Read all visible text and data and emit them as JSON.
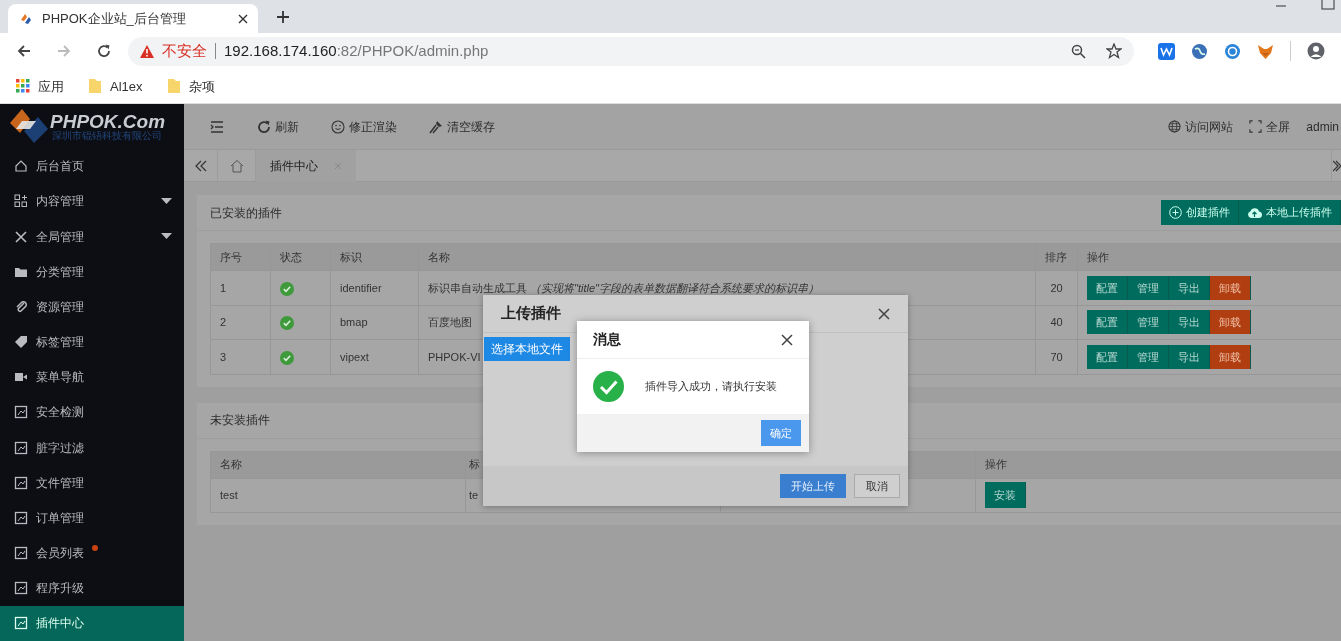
{
  "browser": {
    "tab_title": "PHPOK企业站_后台管理",
    "security_label": "不安全",
    "url_host": "192.168.174.160",
    "url_path": ":82/PHPOK/admin.php",
    "bookmarks": [
      {
        "kind": "apps",
        "label": "应用"
      },
      {
        "kind": "folder",
        "label": "Al1ex"
      },
      {
        "kind": "folder",
        "label": "杂项"
      }
    ]
  },
  "logo": {
    "brand": "PHPOK.Com",
    "company": "深圳市锟铻科技有限公司"
  },
  "toolbar": [
    {
      "kind": "menu"
    },
    {
      "kind": "refresh",
      "label": "刷新"
    },
    {
      "kind": "smile",
      "label": "修正渲染"
    },
    {
      "kind": "broom",
      "label": "清空缓存"
    }
  ],
  "header_right": [
    {
      "kind": "globe",
      "label": "访问网站"
    },
    {
      "kind": "fullscreen",
      "label": "全屏"
    },
    {
      "kind": "user",
      "label": "admin"
    }
  ],
  "page_tabs": [
    {
      "label": "插件中心",
      "selected": true
    }
  ],
  "sidebar": [
    {
      "kind": "home",
      "label": "后台首页",
      "expandable": false,
      "badge_dot": false,
      "selected": false
    },
    {
      "kind": "grid",
      "label": "内容管理",
      "expandable": true,
      "badge_dot": false,
      "selected": false
    },
    {
      "kind": "tools",
      "label": "全局管理",
      "expandable": true,
      "badge_dot": false,
      "selected": false
    },
    {
      "kind": "folder",
      "label": "分类管理",
      "expandable": false,
      "badge_dot": false,
      "selected": false
    },
    {
      "kind": "clip",
      "label": "资源管理",
      "expandable": false,
      "badge_dot": false,
      "selected": false
    },
    {
      "kind": "tag",
      "label": "标签管理",
      "expandable": false,
      "badge_dot": false,
      "selected": false
    },
    {
      "kind": "video",
      "label": "菜单导航",
      "expandable": false,
      "badge_dot": false,
      "selected": false
    },
    {
      "kind": "panel",
      "label": "安全检测",
      "expandable": false,
      "badge_dot": false,
      "selected": false
    },
    {
      "kind": "panel",
      "label": "脏字过滤",
      "expandable": false,
      "badge_dot": false,
      "selected": false
    },
    {
      "kind": "panel",
      "label": "文件管理",
      "expandable": false,
      "badge_dot": false,
      "selected": false
    },
    {
      "kind": "panel",
      "label": "订单管理",
      "expandable": false,
      "badge_dot": false,
      "selected": false
    },
    {
      "kind": "panel",
      "label": "会员列表",
      "expandable": false,
      "badge_dot": true,
      "selected": false
    },
    {
      "kind": "panel",
      "label": "程序升级",
      "expandable": false,
      "badge_dot": false,
      "selected": false
    },
    {
      "kind": "panel",
      "label": "插件中心",
      "expandable": false,
      "badge_dot": false,
      "selected": true
    }
  ],
  "installed": {
    "title": "已安装的插件",
    "actions": [
      {
        "kind": "plus",
        "label": "创建插件"
      },
      {
        "kind": "cloud",
        "label": "本地上传插件"
      }
    ],
    "columns": [
      "序号",
      "状态",
      "标识",
      "名称",
      "排序",
      "操作"
    ],
    "rows": [
      {
        "index": "1",
        "enabled": true,
        "id": "identifier",
        "name": "标识串自动生成工具 *（实现将\"title\"字段的表单数据翻译符合系统要求的标识串）*",
        "order": "20",
        "actions": [
          {
            "kind": "normal",
            "label": "配置"
          },
          {
            "kind": "normal",
            "label": "管理"
          },
          {
            "kind": "normal",
            "label": "导出"
          },
          {
            "kind": "danger",
            "label": "卸载"
          }
        ]
      },
      {
        "index": "2",
        "enabled": true,
        "id": "bmap",
        "name": "百度地图",
        "order": "40",
        "actions": [
          {
            "kind": "normal",
            "label": "配置"
          },
          {
            "kind": "normal",
            "label": "管理"
          },
          {
            "kind": "normal",
            "label": "导出"
          },
          {
            "kind": "danger",
            "label": "卸载"
          }
        ]
      },
      {
        "index": "3",
        "enabled": true,
        "id": "vipext",
        "name": "PHPOK-VI",
        "order": "70",
        "actions": [
          {
            "kind": "normal",
            "label": "配置"
          },
          {
            "kind": "normal",
            "label": "管理"
          },
          {
            "kind": "normal",
            "label": "导出"
          },
          {
            "kind": "danger",
            "label": "卸载"
          }
        ]
      }
    ]
  },
  "uninstalled": {
    "title": "未安装插件",
    "columns": [
      "名称",
      "标",
      "操作"
    ],
    "rows": [
      {
        "name": "test",
        "id": "te",
        "action": "安装"
      }
    ]
  },
  "upload_dialog": {
    "title": "上传插件",
    "choose_button": "选择本地文件",
    "submit_button": "开始上传",
    "cancel_button": "取消"
  },
  "message_dialog": {
    "title": "消息",
    "text": "插件导入成功，请执行安装",
    "ok_button": "确定"
  }
}
